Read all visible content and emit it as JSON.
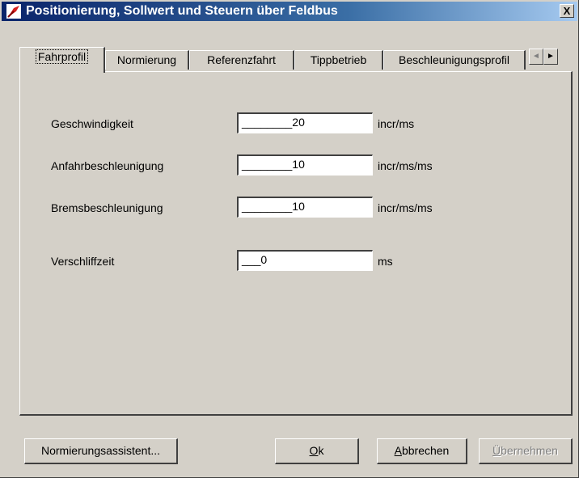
{
  "window": {
    "title": "Positionierung, Sollwert und Steuern über Feldbus",
    "close_label": "X"
  },
  "tabs": [
    {
      "label": "Fahrprofil",
      "active": true
    },
    {
      "label": "Normierung",
      "active": false
    },
    {
      "label": "Referenzfahrt",
      "active": false
    },
    {
      "label": "Tippbetrieb",
      "active": false
    },
    {
      "label": "Beschleunigungsprofil",
      "active": false
    }
  ],
  "tab_scroll": {
    "left": "◄",
    "right": "►"
  },
  "fields": [
    {
      "label": "Geschwindigkeit",
      "value": "________20",
      "unit": "incr/ms"
    },
    {
      "label": "Anfahrbeschleunigung",
      "value": "________10",
      "unit": "incr/ms/ms"
    },
    {
      "label": "Bremsbeschleunigung",
      "value": "________10",
      "unit": "incr/ms/ms"
    },
    {
      "label": "Verschliffzeit",
      "value": "___0",
      "unit": "ms"
    }
  ],
  "buttons": {
    "assistant": "Normierungsassistent...",
    "ok_mnemonic": "O",
    "ok_rest": "k",
    "cancel_mnemonic": "A",
    "cancel_rest": "bbrechen",
    "apply_mnemonic": "Ü",
    "apply_rest": "bernehmen"
  },
  "colors": {
    "title_bar": "#0a246a",
    "face": "#d4d0c8"
  }
}
